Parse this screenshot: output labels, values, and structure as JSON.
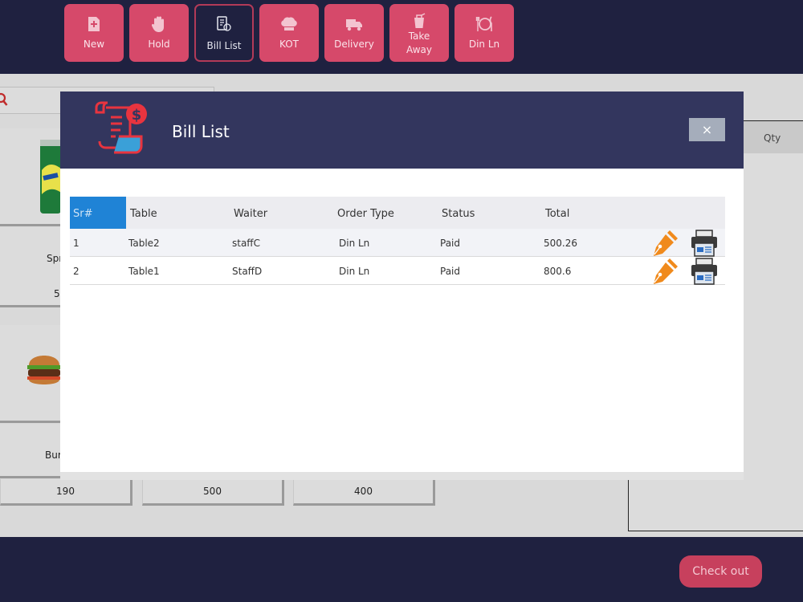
{
  "toolbar": {
    "new_label": "New",
    "hold_label": "Hold",
    "bill_list_label": "Bill List",
    "kot_label": "KOT",
    "delivery_label": "Delivery",
    "take_away_line1": "Take",
    "take_away_line2": "Away",
    "din_ln_label": "Din Ln"
  },
  "products": {
    "item1_name": "Spr",
    "item1_price": "5",
    "item2_name": "Bur",
    "prices": [
      "190",
      "500",
      "400"
    ]
  },
  "cart": {
    "qty_header": "Qty"
  },
  "checkout_label": "Check out",
  "modal": {
    "title": "Bill List",
    "close_glyph": "×",
    "columns": [
      "Sr#",
      "Table",
      "Waiter",
      "Order Type",
      "Status",
      "Total"
    ],
    "rows": [
      {
        "sr": "1",
        "table": "Table2",
        "waiter": "staffC",
        "order_type": "Din Ln",
        "status": "Paid",
        "total": "500.26"
      },
      {
        "sr": "2",
        "table": "Table1",
        "waiter": "StaffD",
        "order_type": "Din Ln",
        "status": "Paid",
        "total": "800.6"
      }
    ]
  },
  "colors": {
    "toolbar_bg": "#1f2140",
    "button_pink": "#d6496a",
    "modal_header": "#33365e",
    "header_highlight": "#1f83d6",
    "edit_orange": "#f08a1c"
  },
  "icons": [
    "new-icon",
    "hold-icon",
    "bill-list-icon",
    "kot-icon",
    "delivery-icon",
    "take-away-icon",
    "din-ln-icon",
    "bill-icon",
    "close-icon",
    "edit-pen-icon",
    "printer-icon",
    "search-icon"
  ]
}
